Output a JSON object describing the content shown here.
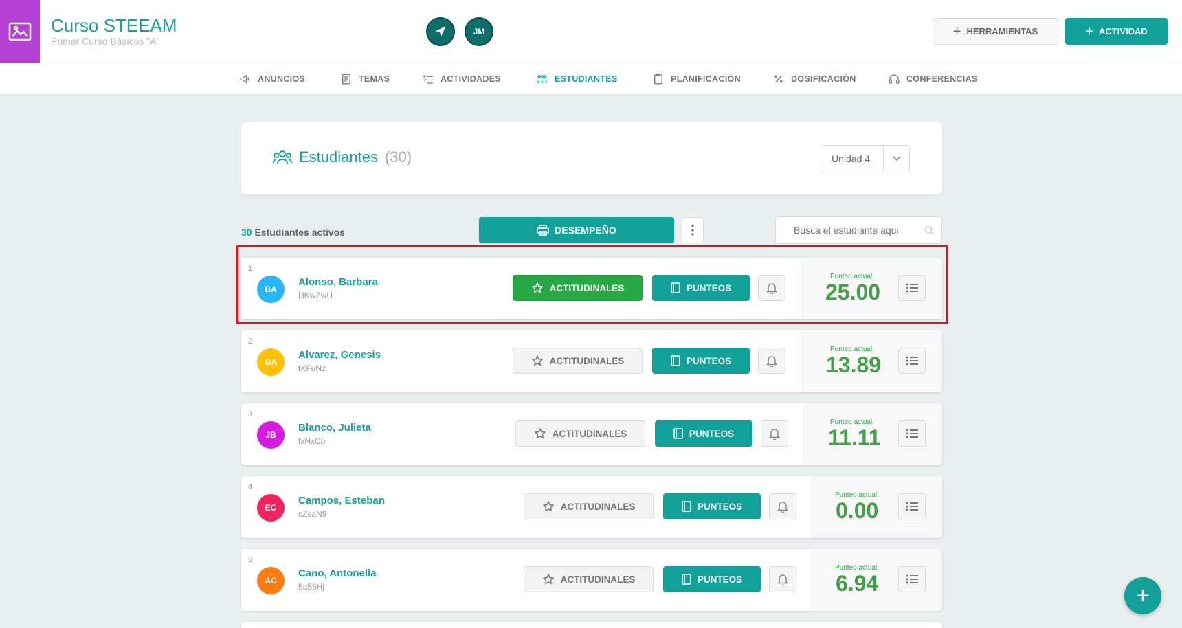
{
  "header": {
    "course_title": "Curso STEEAM",
    "course_subtitle": "Primer Curso Básicos \"A\"",
    "avatar_initials": "JM",
    "tools_label": "HERRAMIENTAS",
    "activity_label": "ACTIVIDAD"
  },
  "nav": {
    "items": [
      {
        "label": "ANUNCIOS",
        "icon": "megaphone-icon"
      },
      {
        "label": "TEMAS",
        "icon": "document-icon"
      },
      {
        "label": "ACTIVIDADES",
        "icon": "checklist-icon"
      },
      {
        "label": "ESTUDIANTES",
        "icon": "students-icon",
        "active": true
      },
      {
        "label": "PLANIFICACIÓN",
        "icon": "clipboard-icon"
      },
      {
        "label": "DOSIFICACIÓN",
        "icon": "percent-icon"
      },
      {
        "label": "CONFERENCIAS",
        "icon": "headset-icon"
      }
    ]
  },
  "panel": {
    "title": "Estudiantes",
    "count": "(30)",
    "unit": "Unidad 4"
  },
  "toolbar": {
    "active_count": "30",
    "active_label": "Estudiantes activos",
    "performance_label": "DESEMPEÑO",
    "search_placeholder": "Busca el estudiante aqui"
  },
  "students": [
    {
      "num": "1",
      "initials": "BA",
      "name": "Alonso, Barbara",
      "code": "HKwZwU",
      "score_label": "Punteo actual:",
      "score": "25.00",
      "color": "#29b6f6",
      "attitudinal_active": true
    },
    {
      "num": "2",
      "initials": "GA",
      "name": "Alvarez, Genesis",
      "code": "tXFuNz",
      "score_label": "Punteo actual:",
      "score": "13.89",
      "color": "#ffc107",
      "attitudinal_active": false
    },
    {
      "num": "3",
      "initials": "JB",
      "name": "Blanco, Julieta",
      "code": "fxNxCp",
      "score_label": "Punteo actual:",
      "score": "11.11",
      "color": "#d81be0",
      "attitudinal_active": false
    },
    {
      "num": "4",
      "initials": "EC",
      "name": "Campos, Esteban",
      "code": "cZsaN9",
      "score_label": "Punteo actual:",
      "score": "0.00",
      "color": "#f0245e",
      "attitudinal_active": false
    },
    {
      "num": "5",
      "initials": "AC",
      "name": "Cano, Antonella",
      "code": "5a55Hj",
      "score_label": "Punteo actual:",
      "score": "6.94",
      "color": "#fb7c13",
      "attitudinal_active": false
    }
  ],
  "buttons": {
    "attitudinal": "ACTITUDINALES",
    "points": "PUNTEOS"
  },
  "fab_label": "+",
  "colors": {
    "accent": "#12a198",
    "green": "#28a745",
    "highlight": "#e3101e",
    "course_thumb": "#b43fd4"
  }
}
